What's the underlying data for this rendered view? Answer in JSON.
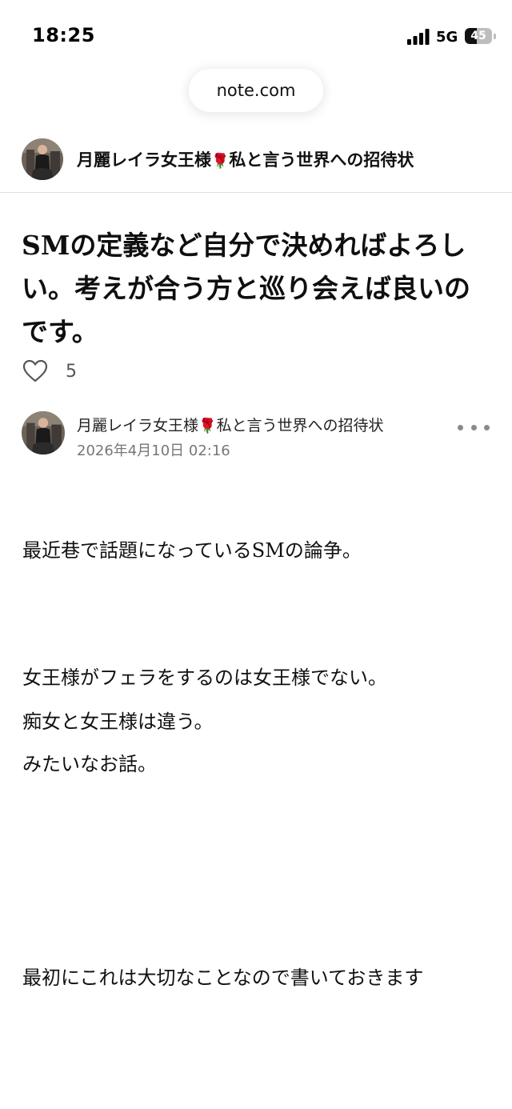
{
  "status_bar": {
    "time": "18:25",
    "network": "5G",
    "battery": "45",
    "battery_level": 0.45
  },
  "browser": {
    "url": "note.com"
  },
  "blog": {
    "name_part1": "月麗レイラ女王様",
    "rose": "🌹",
    "name_part2": "私と言う世界への招待状"
  },
  "article": {
    "title": "SMの定義など自分で決めればよろしい。考えが合う方と巡り会えば良いのです。",
    "likes": "5",
    "author_part1": "月麗レイラ女王様",
    "author_rose": "🌹",
    "author_part2": "私と言う世界への招待状",
    "date": "2026年4月10日 02:16",
    "body": [
      "最近巷で話題になっているSMの論争。",
      "女王様がフェラをするのは女王様でない。",
      "痴女と女王様は違う。",
      "みたいなお話。",
      "最初にこれは大切なことなので書いておきます"
    ]
  },
  "icons": {
    "heart": "heart-icon",
    "more": "more-icon",
    "signal": "signal-icon",
    "battery": "battery-icon"
  },
  "colors": {
    "text": "#0f0f0f",
    "meta": "#777777",
    "rose": "#c8102e",
    "divider": "#dedede"
  }
}
